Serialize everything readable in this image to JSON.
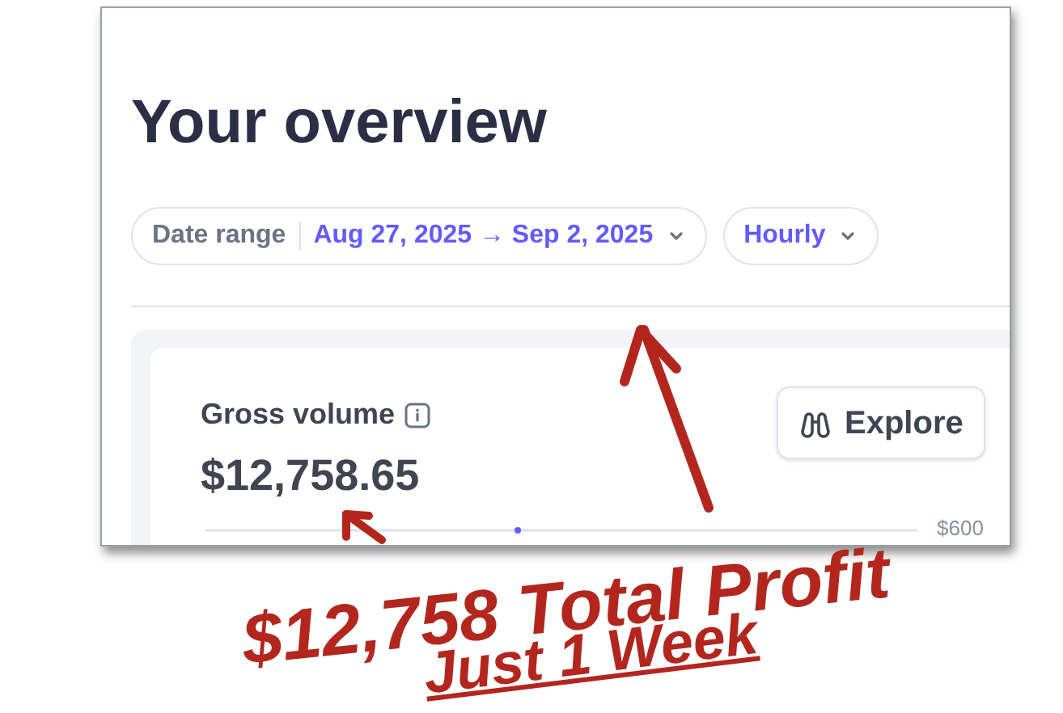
{
  "page": {
    "title": "Your overview"
  },
  "filters": [
    {
      "kind": "date_range",
      "label": "Date range",
      "value": "Aug 27, 2025 → Sep 2, 2025"
    },
    {
      "kind": "interval",
      "value": "Hourly"
    }
  ],
  "metric": {
    "label": "Gross volume",
    "value": "$12,758.65",
    "button": "Explore",
    "axis_label": "$600"
  },
  "annotation": {
    "lines": [
      "$12,758 Total Profit",
      "Just 1 Week"
    ]
  }
}
